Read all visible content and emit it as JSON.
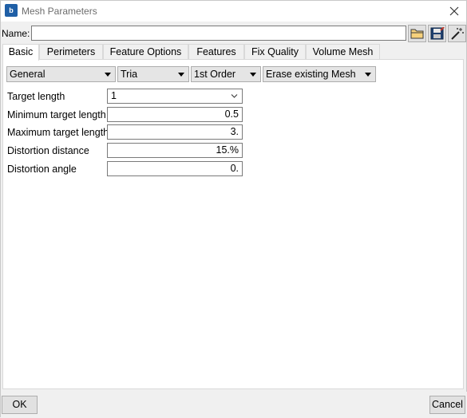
{
  "window": {
    "title": "Mesh Parameters",
    "app_icon": "app-logo-icon",
    "close_icon": "close-icon"
  },
  "name_row": {
    "label": "Name:",
    "value": "",
    "placeholder": "",
    "buttons": [
      {
        "name": "open-folder-button",
        "icon": "folder-icon"
      },
      {
        "name": "save-button",
        "icon": "floppy-disk-icon"
      },
      {
        "name": "magic-wand-button",
        "icon": "magic-wand-icon"
      }
    ]
  },
  "tabs": [
    {
      "label": "Basic",
      "active": true
    },
    {
      "label": "Perimeters",
      "active": false
    },
    {
      "label": "Feature Options",
      "active": false
    },
    {
      "label": "Features",
      "active": false
    },
    {
      "label": "Fix Quality",
      "active": false
    },
    {
      "label": "Volume Mesh",
      "active": false
    }
  ],
  "basic": {
    "combos": [
      {
        "value": "General"
      },
      {
        "value": "Tria"
      },
      {
        "value": "1st Order"
      },
      {
        "value": "Erase existing Mesh"
      }
    ],
    "fields": [
      {
        "label": "Target length",
        "value": "1"
      },
      {
        "label": "Minimum target length",
        "value": "0.5"
      },
      {
        "label": "Maximum target length",
        "value": "3."
      },
      {
        "label": "Distortion distance",
        "value": "15.%"
      },
      {
        "label": "Distortion angle",
        "value": "0."
      }
    ]
  },
  "footer": {
    "ok_label": "OK",
    "cancel_label": "Cancel"
  }
}
